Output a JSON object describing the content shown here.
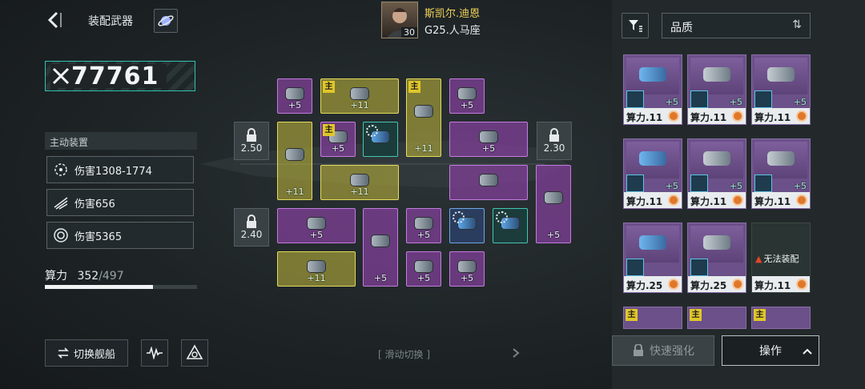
{
  "header": {
    "title": "装配武器"
  },
  "pilot": {
    "name": "斯凯尔.迪恩",
    "ship": "G25.人马座",
    "level": "30"
  },
  "power": {
    "value": "77761"
  },
  "active_section": {
    "title": "主动装置"
  },
  "skills": [
    {
      "label": "伤害1308-1774",
      "icon": "burst-ring-icon"
    },
    {
      "label": "伤害656",
      "icon": "wing-strike-icon"
    },
    {
      "label": "伤害5365",
      "icon": "spiral-ring-icon"
    }
  ],
  "capacity": {
    "label": "算力",
    "used": "352",
    "total": "/497",
    "fraction": 0.708
  },
  "bottom": {
    "switch_ship": "切换舰船",
    "swipe_hint": "滑动切换"
  },
  "locks": [
    "2.50",
    "2.30",
    "2.40"
  ],
  "slots": [
    {
      "level": "+5",
      "color": "p",
      "main": false
    },
    {
      "level": "+11",
      "color": "y",
      "main": true
    },
    {
      "level": "+11",
      "color": "y",
      "main": true
    },
    {
      "level": "+5",
      "color": "p",
      "main": false
    },
    {
      "level": "+11",
      "color": "y",
      "main": false
    },
    {
      "level": "+5",
      "color": "p",
      "main": true
    },
    {
      "level": "",
      "color": "t",
      "main": false
    },
    {
      "level": "+5",
      "color": "p",
      "main": false
    },
    {
      "level": "+11",
      "color": "y",
      "main": false
    },
    {
      "level": "",
      "color": "p",
      "main": false
    },
    {
      "level": "+5",
      "color": "p",
      "main": false
    },
    {
      "level": "+5",
      "color": "p",
      "main": false
    },
    {
      "level": "+5",
      "color": "p",
      "main": false
    },
    {
      "level": "+5",
      "color": "p",
      "main": false
    },
    {
      "level": "",
      "color": "b",
      "main": false
    },
    {
      "level": "",
      "color": "t",
      "main": false
    },
    {
      "level": "+11",
      "color": "y",
      "main": false
    },
    {
      "level": "+5",
      "color": "p",
      "main": false
    },
    {
      "level": "+5",
      "color": "p",
      "main": false
    }
  ],
  "filter": {
    "quality_label": "品质"
  },
  "inventory": [
    {
      "level": "+5",
      "cp": "算力.11",
      "disabled": false
    },
    {
      "level": "+5",
      "cp": "算力.11",
      "disabled": false
    },
    {
      "level": "+5",
      "cp": "算力.11",
      "disabled": false
    },
    {
      "level": "+5",
      "cp": "算力.11",
      "disabled": false
    },
    {
      "level": "+5",
      "cp": "算力.11",
      "disabled": false
    },
    {
      "level": "+5",
      "cp": "算力.11",
      "disabled": false
    },
    {
      "level": "",
      "cp": "算力.25",
      "disabled": false
    },
    {
      "level": "",
      "cp": "算力.25",
      "disabled": false
    },
    {
      "level": "",
      "cp": "算力.11",
      "disabled": true,
      "warning": "无法装配"
    }
  ],
  "inventory_partial_main": "主",
  "main_tag": "主",
  "actions": {
    "quick_upgrade": "快速强化",
    "operate": "操作"
  },
  "colors": {
    "accent": "#2ec4b0",
    "gold": "#e0c62a",
    "purple": "#8a6ca8"
  }
}
